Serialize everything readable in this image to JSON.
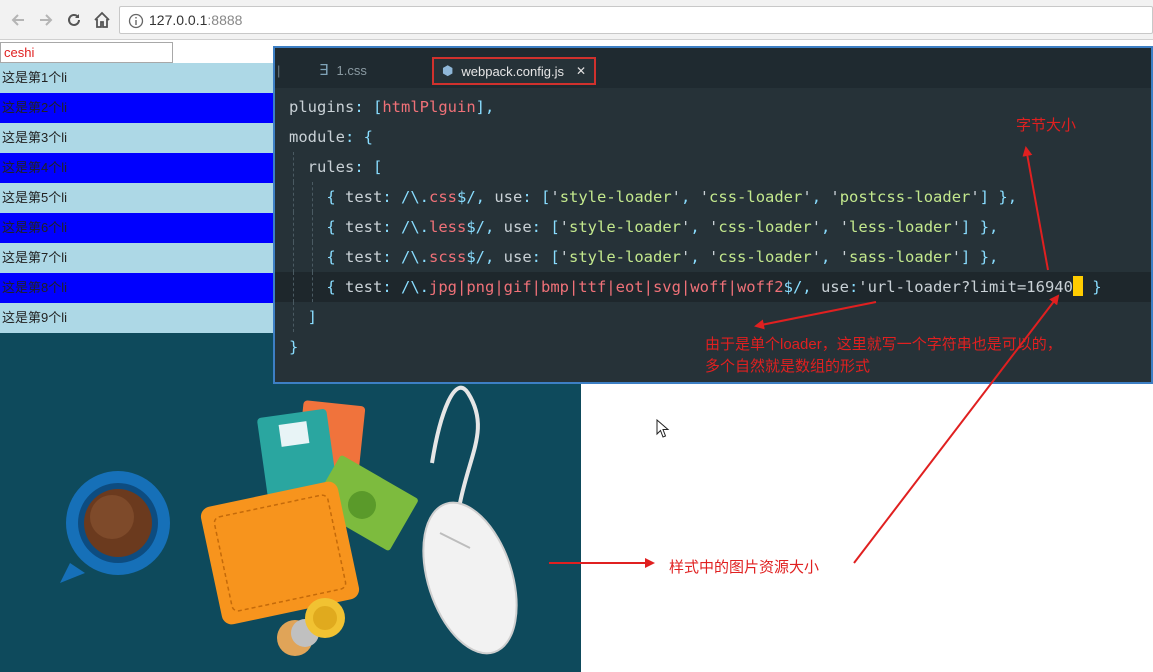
{
  "browser": {
    "url_host": "127.0.0.1",
    "url_port": ":8888",
    "icons": [
      "back-arrow-icon",
      "forward-arrow-icon",
      "reload-icon",
      "home-icon",
      "info-icon"
    ]
  },
  "page": {
    "input_value": "ceshi",
    "list_items": [
      "这是第1个li",
      "这是第2个li",
      "这是第3个li",
      "这是第4个li",
      "这是第5个li",
      "这是第6个li",
      "这是第7个li",
      "这是第8个li",
      "这是第9个li"
    ],
    "list_colors": {
      "odd": "#add8e6",
      "even": "#0000ff"
    }
  },
  "editor": {
    "tabs": [
      {
        "label": "1.css",
        "icon": "css-file-icon",
        "active": false
      },
      {
        "label": "webpack.config.js",
        "icon": "js-file-icon",
        "active": true
      }
    ],
    "close_glyph": "✕",
    "code": {
      "l1_key": "plugins",
      "l1_ident": "htmlPlguin",
      "l2_key": "module",
      "l3_key": "rules",
      "test_kw": "test",
      "use_kw": "use",
      "css_ext": "css",
      "less_ext": "less",
      "scss_ext": "scss",
      "style_loader": "style-loader",
      "css_loader": "css-loader",
      "postcss_loader": "postcss-loader",
      "less_loader": "less-loader",
      "sass_loader": "sass-loader",
      "img_exts": "jpg|png|gif|bmp|ttf|eot|svg|woff|woff2",
      "url_loader": "url-loader?limit=16940"
    }
  },
  "annotations": {
    "byte_size": "字节大小",
    "single_loader_line1": "由于是单个loader，这里就写一个字符串也是可以的，",
    "single_loader_line2": "多个自然就是数组的形式",
    "image_size": "样式中的图片资源大小"
  },
  "colors": {
    "annotation": "#e02020",
    "editor_bg": "#263238",
    "illustration_bg": "#0e4a5c"
  }
}
